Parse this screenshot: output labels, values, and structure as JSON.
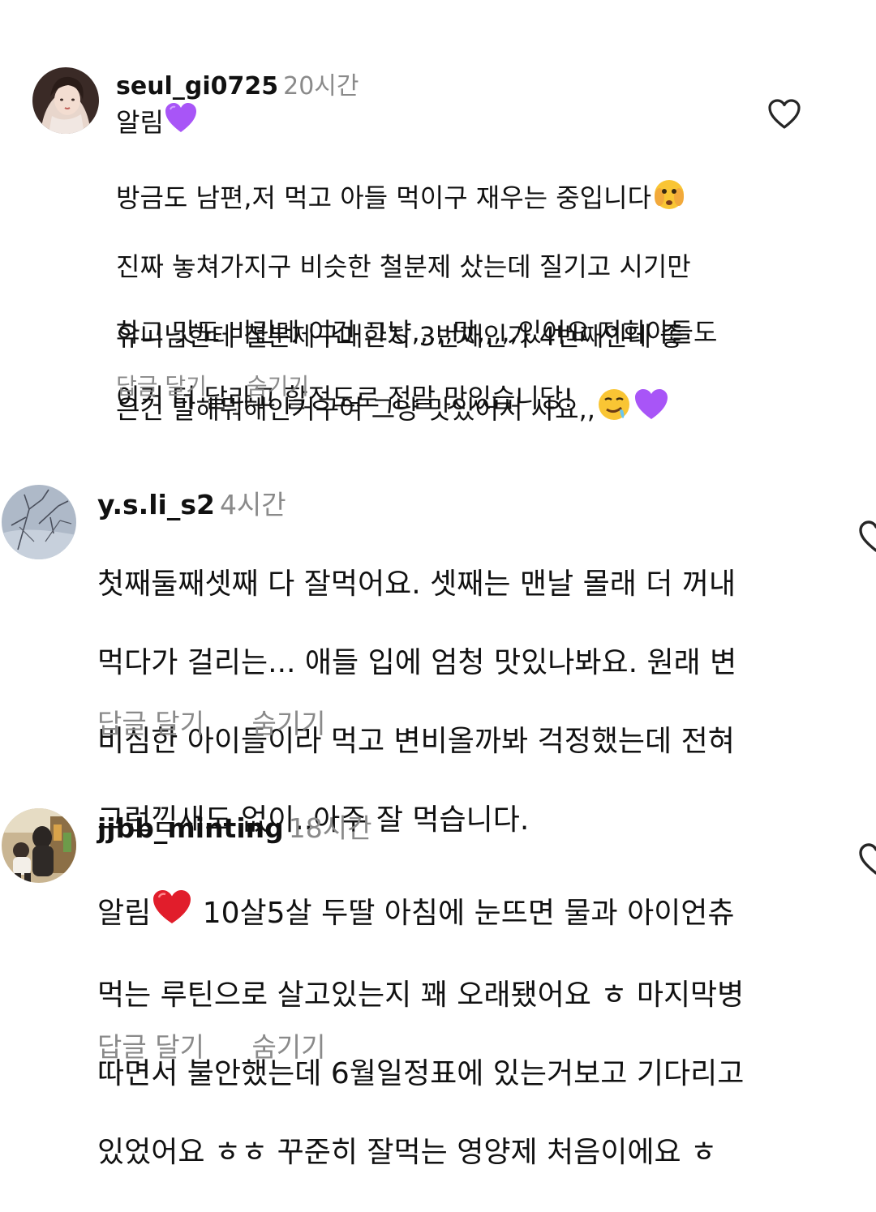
{
  "comments": [
    {
      "username": "seul_gi0725",
      "time": "20시간",
      "first_line": "알림",
      "paragraph1": [
        "방금도 남편,저 먹고 아들 먹이구 재우는 중입니다",
        "진짜 놓쳐가지구 비슷한 철분제 샀는데 질기고 시기만",
        "하고 맛도 비린데 이건 그냥,,,,,맛,,,,,있어요 저희아들도",
        "이거 더 달라고 할정도로 정말 맛있습니당!"
      ],
      "paragraph2": [
        "유니님한테 철분제구매한지 3번째인가 4번째인데 좋",
        "은건 말해뭐해인거구여 그냥 맛있어서 사요,,"
      ],
      "reply_label": "답글 달기",
      "hide_label": "숨기기",
      "icons": [
        "purple-heart-emoji",
        "peeking-face-emoji",
        "drooling-face-emoji",
        "heart-outline-icon"
      ]
    },
    {
      "username": "y.s.li_s2",
      "time": "4시간",
      "lines": [
        "첫째둘째셋째 다 잘먹어요. 셋째는 맨날 몰래 더 꺼내",
        "먹다가 걸리는... 애들 입에 엄청 맛있나봐요. 원래 변",
        "비심한 아이들이라 먹고 변비올까봐 걱정했는데 전혀",
        "그런낌새도 없이..아주 잘 먹습니다."
      ],
      "reply_label": "답글 달기",
      "hide_label": "숨기기"
    },
    {
      "username": "jjbb_minting",
      "time": "18시간",
      "first_line_prefix": "알림",
      "lines": [
        " 10살5살 두딸 아침에 눈뜨면 물과 아이언츄",
        "먹는 루틴으로 살고있는지 꽤 오래됐어요 ㅎ 마지막병",
        "따면서 불안했는데 6월일정표에 있는거보고 기다리고",
        "있었어요 ㅎㅎ 꾸준히 잘먹는 영양제 처음이에요 ㅎ"
      ],
      "reply_label": "답글 달기",
      "hide_label": "숨기기",
      "icons": [
        "red-heart-emoji",
        "heart-outline-icon"
      ]
    }
  ]
}
